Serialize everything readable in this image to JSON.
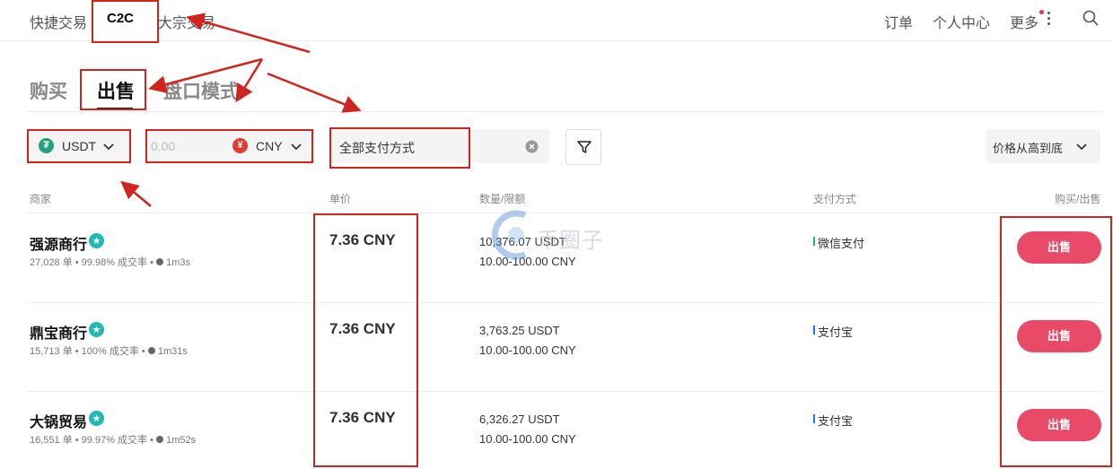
{
  "top_nav": {
    "tabs": [
      "快捷交易",
      "C2C",
      "大宗交易"
    ],
    "orders": "订单",
    "profile": "个人中心",
    "more": "更多"
  },
  "sub_tabs": [
    "购买",
    "出售",
    "盘口模式"
  ],
  "filters": {
    "coin": "USDT",
    "amount_placeholder": "0.00",
    "fiat": "CNY",
    "fiat_symbol": "¥",
    "payment": "全部支付方式",
    "sort": "价格从高到底"
  },
  "columns": [
    "商家",
    "单价",
    "数量/限额",
    "支付方式",
    "购买/出售"
  ],
  "rows": [
    {
      "merchant": "强源商行",
      "stats_orders": "27,028 单",
      "stats_rate": "99.98% 成交率",
      "stats_time": "1m3s",
      "price": "7.36 CNY",
      "quantity": "10,376.07 USDT",
      "limit": "10.00-100.00 CNY",
      "payment": "微信支付",
      "action": "出售"
    },
    {
      "merchant": "鼎宝商行",
      "stats_orders": "15,713 单",
      "stats_rate": "100% 成交率",
      "stats_time": "1m31s",
      "price": "7.36 CNY",
      "quantity": "3,763.25 USDT",
      "limit": "10.00-100.00 CNY",
      "payment": "支付宝",
      "action": "出售"
    },
    {
      "merchant": "大锅贸易",
      "stats_orders": "16,551 单",
      "stats_rate": "99.97% 成交率",
      "stats_time": "1m52s",
      "price": "7.36 CNY",
      "quantity": "6,326.27 USDT",
      "limit": "10.00-100.00 CNY",
      "payment": "支付宝",
      "action": "出售"
    }
  ],
  "watermark": "币圈子",
  "colors": {
    "accent": "#e84a67",
    "highlight": "#d0251f",
    "tether": "#26a17b",
    "cny": "#e23d33",
    "wechat": "#2aae67",
    "alipay": "#1677ff"
  }
}
